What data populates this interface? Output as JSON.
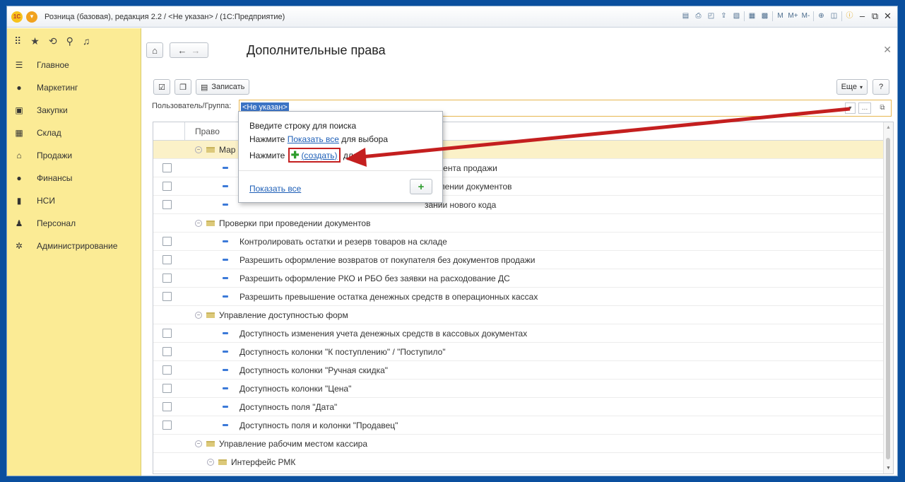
{
  "window": {
    "logo": "1С",
    "title": "Розница (базовая), редакция 2.2 / <Не указан> / (1С:Предприятие)",
    "toolbar_icons": [
      "save-icon",
      "print-icon",
      "preview-icon",
      "upload-icon",
      "find-icon",
      "calculator-icon",
      "calendar-icon"
    ],
    "memory": [
      "M",
      "M+",
      "M-"
    ],
    "controls": [
      "–",
      "⧉",
      "✕"
    ]
  },
  "sidebar": {
    "top_icons": [
      "apps-icon",
      "star-icon",
      "history-icon",
      "search-icon",
      "bell-icon"
    ],
    "items": [
      {
        "label": "Главное",
        "icon": "menu-icon"
      },
      {
        "label": "Маркетинг",
        "icon": "marketing-icon"
      },
      {
        "label": "Закупки",
        "icon": "purchases-icon"
      },
      {
        "label": "Склад",
        "icon": "warehouse-icon"
      },
      {
        "label": "Продажи",
        "icon": "sales-icon"
      },
      {
        "label": "Финансы",
        "icon": "finance-icon"
      },
      {
        "label": "НСИ",
        "icon": "reference-icon"
      },
      {
        "label": "Персонал",
        "icon": "staff-icon"
      },
      {
        "label": "Администрирование",
        "icon": "admin-icon"
      }
    ]
  },
  "form": {
    "title": "Дополнительные права",
    "save_label": "Записать",
    "more_label": "Еще",
    "help_label": "?",
    "user_label": "Пользователь/Группа:",
    "user_value": "<Не указан>"
  },
  "grid": {
    "header": "Право",
    "rows": [
      {
        "type": "group",
        "level": 1,
        "label": "Мар",
        "selected": true
      },
      {
        "type": "leaf",
        "label": "окумента продажи"
      },
      {
        "type": "leaf",
        "label": "ормлении документов"
      },
      {
        "type": "leaf",
        "label": "зании нового кода"
      },
      {
        "type": "group",
        "level": 1,
        "label": "Проверки при проведении документов"
      },
      {
        "type": "leaf",
        "label": "Контролировать остатки и резерв товаров на складе"
      },
      {
        "type": "leaf",
        "label": "Разрешить оформление возвратов от покупателя без документов продажи"
      },
      {
        "type": "leaf",
        "label": "Разрешить оформление РКО и РБО без заявки на расходование ДС"
      },
      {
        "type": "leaf",
        "label": "Разрешить превышение остатка денежных средств в операционных кассах"
      },
      {
        "type": "group",
        "level": 1,
        "label": "Управление доступностью форм"
      },
      {
        "type": "leaf",
        "label": "Доступность изменения учета денежных средств в кассовых документах"
      },
      {
        "type": "leaf",
        "label": "Доступность колонки \"К поступлению\" / \"Поступило\""
      },
      {
        "type": "leaf",
        "label": "Доступность колонки \"Ручная скидка\""
      },
      {
        "type": "leaf",
        "label": "Доступность колонки \"Цена\""
      },
      {
        "type": "leaf",
        "label": "Доступность поля \"Дата\""
      },
      {
        "type": "leaf",
        "label": "Доступность поля и колонки \"Продавец\""
      },
      {
        "type": "group",
        "level": 1,
        "label": "Управление рабочим местом кассира"
      },
      {
        "type": "group",
        "level": 2,
        "label": "Интерфейс РМК"
      }
    ]
  },
  "popup": {
    "line1": "Введите строку для поиска",
    "line2_prefix": "Нажмите ",
    "line2_link": "Показать все",
    "line2_suffix": " для выбора",
    "line3_prefix": "Нажмите ",
    "line3_link": "(создать)",
    "line3_suffix": " для",
    "show_all": "Показать все",
    "add_button": "+"
  },
  "colors": {
    "sidebar_bg": "#fbeb95",
    "selection": "#fbf1c8",
    "accent_arrow": "#c41f1f",
    "link": "#1e5fb7"
  }
}
